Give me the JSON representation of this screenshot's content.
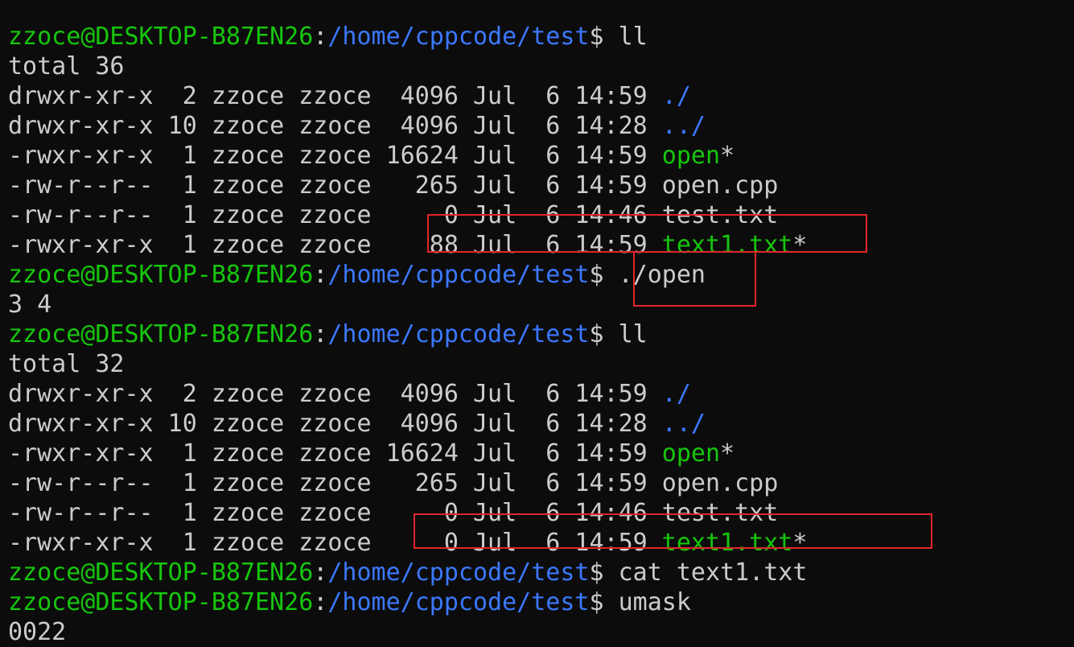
{
  "prompt": {
    "user_host": "zzoce@DESKTOP-B87EN26",
    "sep": ":",
    "path": "/home/cppcode/test",
    "symbol": "$ "
  },
  "lines": [
    {
      "type": "partial",
      "text": ""
    },
    {
      "type": "prompt",
      "cmd": "ll"
    },
    {
      "type": "text",
      "text": "total 36"
    },
    {
      "type": "entry",
      "meta": "drwxr-xr-x  2 zzoce zzoce  4096 Jul  6 14:59 ",
      "name": "./",
      "kind": "dir",
      "suffix": ""
    },
    {
      "type": "entry",
      "meta": "drwxr-xr-x 10 zzoce zzoce  4096 Jul  6 14:28 ",
      "name": "../",
      "kind": "dir",
      "suffix": ""
    },
    {
      "type": "entry",
      "meta": "-rwxr-xr-x  1 zzoce zzoce 16624 Jul  6 14:59 ",
      "name": "open",
      "kind": "exec",
      "suffix": "*"
    },
    {
      "type": "entry",
      "meta": "-rw-r--r--  1 zzoce zzoce   265 Jul  6 14:59 ",
      "name": "open.cpp",
      "kind": "plain",
      "suffix": ""
    },
    {
      "type": "entry",
      "meta": "-rw-r--r--  1 zzoce zzoce     0 Jul  6 14:46 ",
      "name": "test.txt",
      "kind": "plain",
      "suffix": ""
    },
    {
      "type": "entry",
      "meta": "-rwxr-xr-x  1 zzoce zzoce    88 Jul  6 14:59 ",
      "name": "text1.txt",
      "kind": "exec",
      "suffix": "*"
    },
    {
      "type": "prompt",
      "cmd": "./open"
    },
    {
      "type": "text",
      "text": "3 4"
    },
    {
      "type": "prompt",
      "cmd": "ll"
    },
    {
      "type": "text",
      "text": "total 32"
    },
    {
      "type": "entry",
      "meta": "drwxr-xr-x  2 zzoce zzoce  4096 Jul  6 14:59 ",
      "name": "./",
      "kind": "dir",
      "suffix": ""
    },
    {
      "type": "entry",
      "meta": "drwxr-xr-x 10 zzoce zzoce  4096 Jul  6 14:28 ",
      "name": "../",
      "kind": "dir",
      "suffix": ""
    },
    {
      "type": "entry",
      "meta": "-rwxr-xr-x  1 zzoce zzoce 16624 Jul  6 14:59 ",
      "name": "open",
      "kind": "exec",
      "suffix": "*"
    },
    {
      "type": "entry",
      "meta": "-rw-r--r--  1 zzoce zzoce   265 Jul  6 14:59 ",
      "name": "open.cpp",
      "kind": "plain",
      "suffix": ""
    },
    {
      "type": "entry",
      "meta": "-rw-r--r--  1 zzoce zzoce     0 Jul  6 14:46 ",
      "name": "test.txt",
      "kind": "plain",
      "suffix": ""
    },
    {
      "type": "entry",
      "meta": "-rwxr-xr-x  1 zzoce zzoce     0 Jul  6 14:59 ",
      "name": "text1.txt",
      "kind": "exec",
      "suffix": "*"
    },
    {
      "type": "prompt",
      "cmd": "cat text1.txt"
    },
    {
      "type": "prompt",
      "cmd": "umask"
    },
    {
      "type": "text",
      "text": "0022"
    }
  ],
  "colors": {
    "background": "#0c0c0c",
    "foreground": "#cccccc",
    "user_host": "#16c60c",
    "path": "#3b78ff",
    "executable": "#16c60c",
    "directory": "#3b78ff",
    "highlight_box": "#e0262b"
  }
}
